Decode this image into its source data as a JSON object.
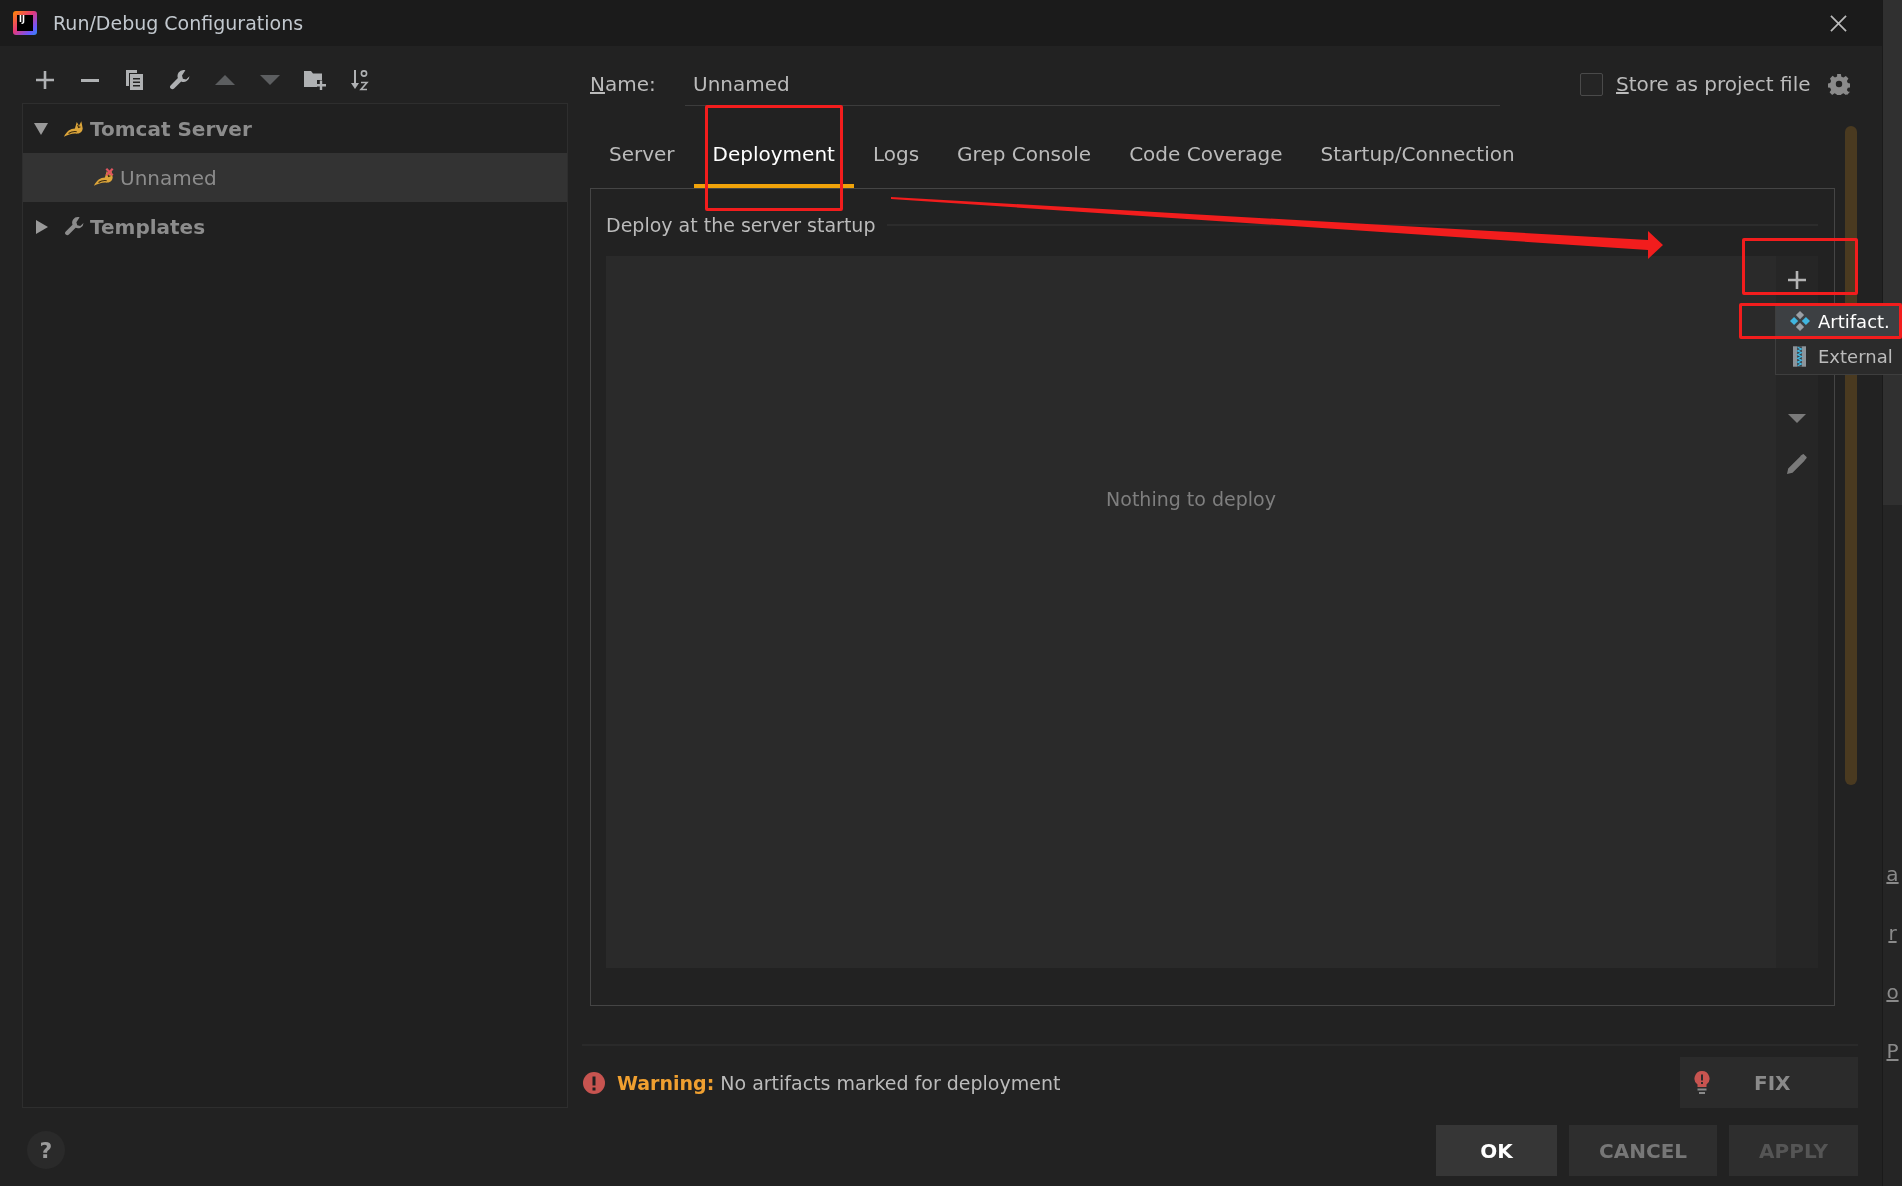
{
  "window": {
    "title": "Run/Debug Configurations",
    "logo": "IJ"
  },
  "left_toolbar": [
    {
      "kind": "add",
      "disabled": false
    },
    {
      "kind": "remove",
      "disabled": false
    },
    {
      "kind": "copy",
      "disabled": false
    },
    {
      "kind": "edit-templates",
      "disabled": false
    },
    {
      "kind": "move-up",
      "disabled": true
    },
    {
      "kind": "move-down",
      "disabled": true
    },
    {
      "kind": "new-folder",
      "disabled": false
    },
    {
      "kind": "sort",
      "disabled": false
    }
  ],
  "tree": [
    {
      "label": "Tomcat Server",
      "kind": "server",
      "expanded": true,
      "selected": false,
      "children": [
        {
          "label": "Unnamed",
          "kind": "config",
          "selected": true,
          "error": true
        }
      ]
    },
    {
      "label": "Templates",
      "kind": "templates",
      "expanded": false,
      "selected": false
    }
  ],
  "help": "?",
  "name_field": {
    "label": "Name:",
    "value": "Unnamed"
  },
  "store_as_project_file": {
    "label": "Store as project file",
    "checked": false
  },
  "tabs": [
    {
      "label": "Server",
      "selected": false,
      "annotated": false
    },
    {
      "label": "Deployment",
      "selected": true,
      "annotated": true
    },
    {
      "label": "Logs",
      "selected": false,
      "annotated": false
    },
    {
      "label": "Grep Console",
      "selected": false,
      "annotated": false
    },
    {
      "label": "Code Coverage",
      "selected": false,
      "annotated": false
    },
    {
      "label": "Startup/Connection",
      "selected": false,
      "annotated": false
    }
  ],
  "deployment": {
    "title": "Deploy at the server startup",
    "empty_text": "Nothing to deploy",
    "toolbar": [
      {
        "kind": "add",
        "disabled": false,
        "annotated": true
      },
      {
        "kind": "move-down",
        "disabled": true,
        "annotated": false
      },
      {
        "kind": "edit",
        "disabled": true,
        "annotated": false
      }
    ],
    "add_menu": [
      {
        "kind": "artifact",
        "label": "Artifact.",
        "selected": true,
        "annotated": true
      },
      {
        "kind": "external",
        "label": "External",
        "selected": false,
        "annotated": false
      }
    ]
  },
  "warning": {
    "text": "**Warning:** No artifacts marked for deployment"
  },
  "fix_button": {
    "label": "FIX"
  },
  "buttons": [
    {
      "label": "OK",
      "kind": "default",
      "disabled": false
    },
    {
      "label": "CANCEL",
      "kind": "normal",
      "disabled": false
    },
    {
      "label": "APPLY",
      "kind": "normal",
      "disabled": true
    }
  ],
  "background_window": {
    "letters": [
      "a",
      "r",
      "o",
      "P"
    ]
  }
}
